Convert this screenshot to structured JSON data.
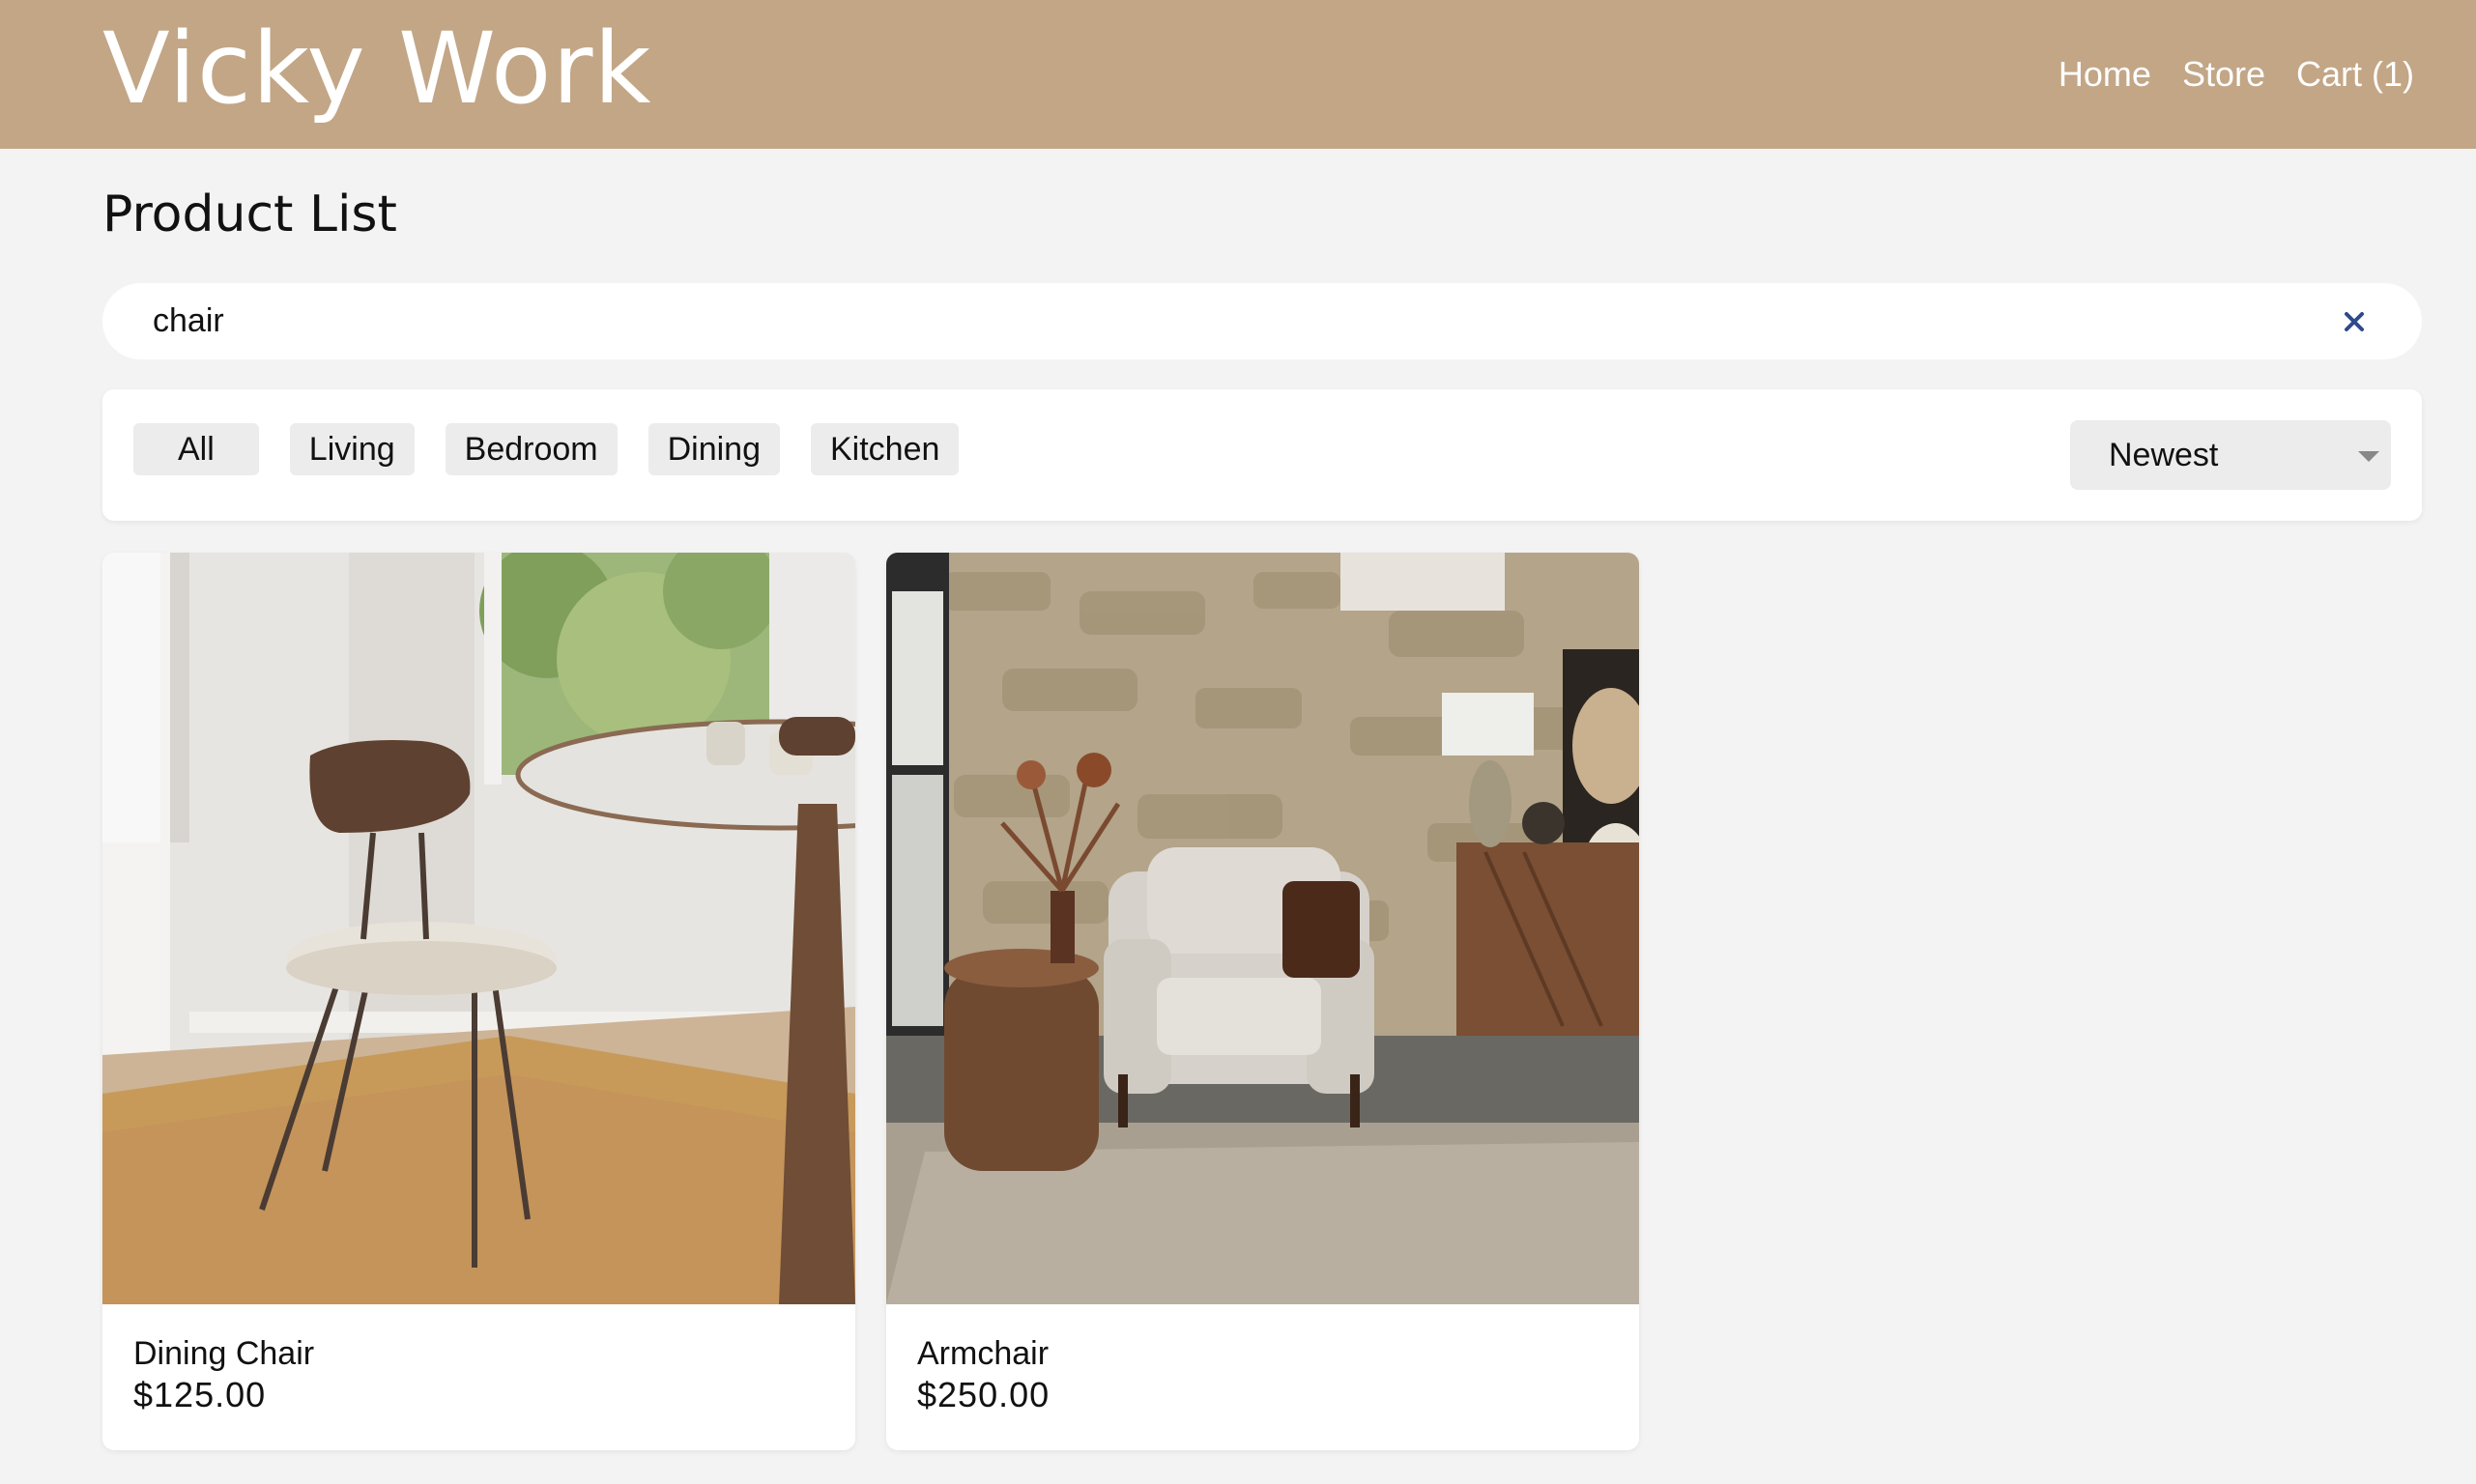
{
  "header": {
    "brand": "Vicky Work",
    "nav": {
      "home": "Home",
      "store": "Store",
      "cart": "Cart (1)"
    }
  },
  "page_title": "Product List",
  "search": {
    "value": "chair",
    "placeholder": ""
  },
  "filters": {
    "categories": [
      "All",
      "Living",
      "Bedroom",
      "Dining",
      "Kitchen"
    ],
    "sort_selected": "Newest"
  },
  "products": [
    {
      "name": "Dining Chair",
      "price": "$125.00",
      "image": "dining-chair-photo"
    },
    {
      "name": "Armchair",
      "price": "$250.00",
      "image": "armchair-photo"
    }
  ],
  "colors": {
    "header_bg": "#c2a686",
    "page_bg": "#f3f3f3",
    "clear_icon": "#2f4a8a"
  }
}
